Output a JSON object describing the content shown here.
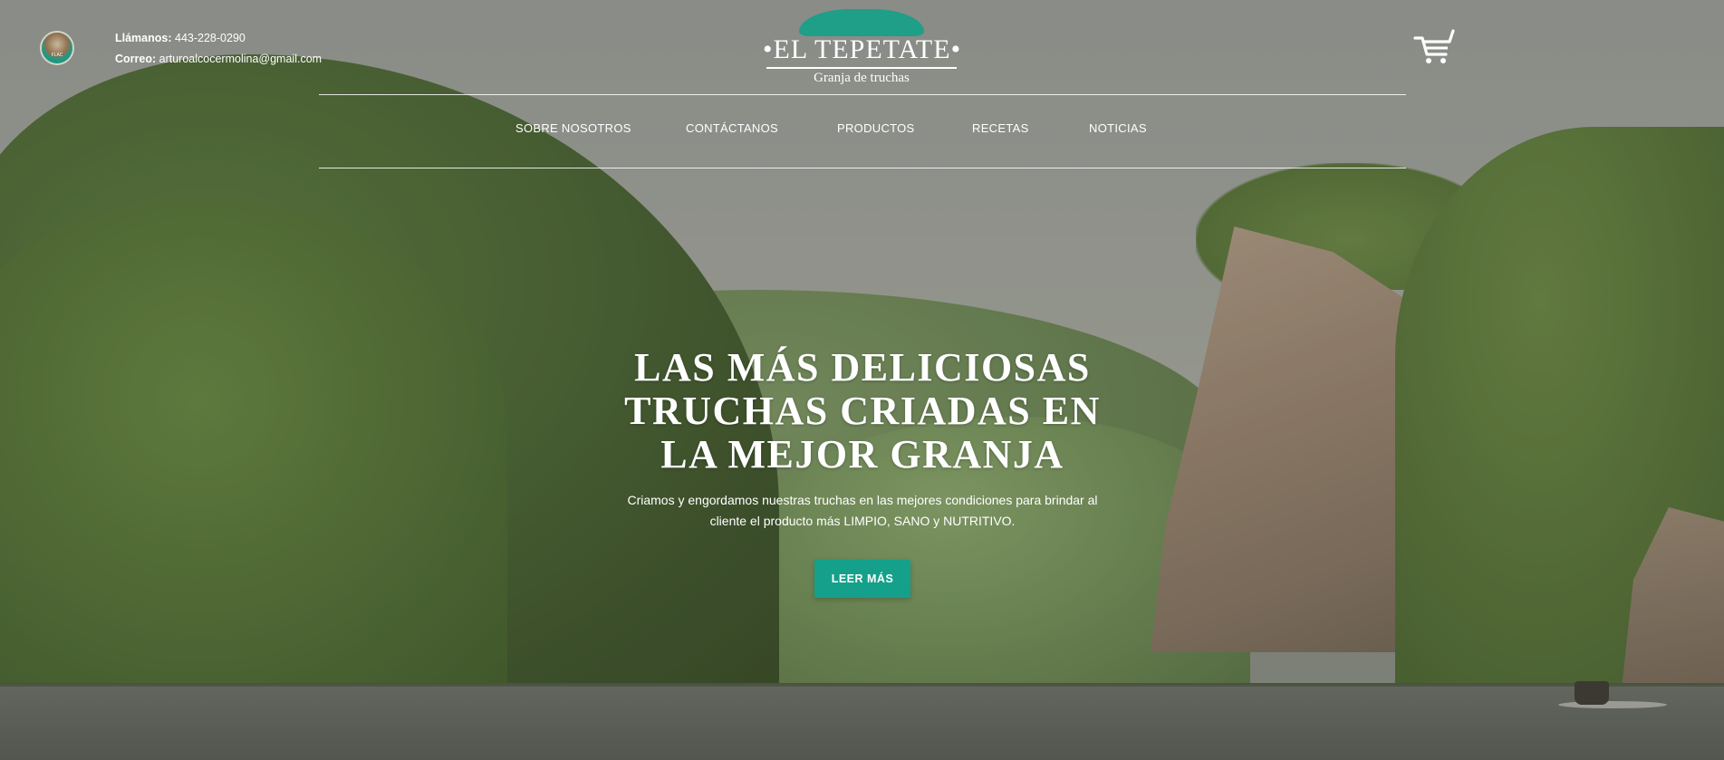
{
  "header": {
    "badge_text": "FLAC",
    "contact": {
      "phone_label": "Llámanos:",
      "phone_value": "443-228-0290",
      "email_label": "Correo:",
      "email_value": "arturoalcocermolina@gmail.com"
    },
    "logo": {
      "title": "•EL TEPETATE•",
      "subtitle": "Granja de truchas",
      "accent_color": "#1f9e88"
    },
    "cart_icon": "cart-icon"
  },
  "nav": {
    "items": [
      {
        "label": "SOBRE NOSOTROS"
      },
      {
        "label": "CONTÁCTANOS"
      },
      {
        "label": "PRODUCTOS"
      },
      {
        "label": "RECETAS"
      },
      {
        "label": "NOTICIAS"
      }
    ]
  },
  "hero": {
    "title_lines": [
      "LAS MÁS DELICIOSAS",
      "TRUCHAS CRIADAS EN",
      "LA MEJOR GRANJA"
    ],
    "subtitle_lines": [
      "Criamos y engordamos nuestras truchas en las mejores condiciones para brindar al",
      "cliente el producto más LIMPIO, SANO y NUTRITIVO."
    ],
    "cta_label": "LEER MÁS",
    "cta_color": "#14a08a"
  }
}
